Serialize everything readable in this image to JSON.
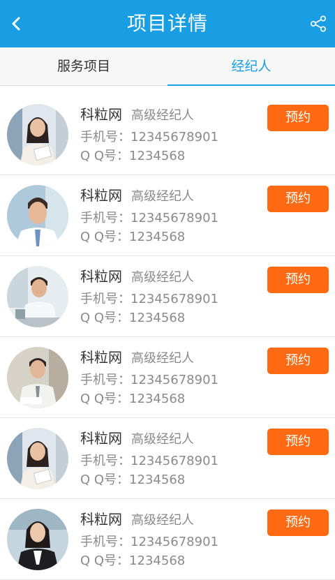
{
  "header": {
    "title": "项目详情",
    "back_icon": "chevron-left-icon",
    "share_icon": "share-icon"
  },
  "tabs": [
    {
      "label": "服务项目",
      "active": false
    },
    {
      "label": "经纪人",
      "active": true
    }
  ],
  "colors": {
    "header_bg": "#1a9ee3",
    "accent": "#1a9ee3",
    "button_bg": "#ff6a13"
  },
  "agents": [
    {
      "name": "科粒网",
      "level": "高级经纪人",
      "phone": "手机号：12345678901",
      "qq": "Q Q号：1234568",
      "button": "预约",
      "avatar": "woman-holding-papers"
    },
    {
      "name": "科粒网",
      "level": "高级经纪人",
      "phone": "手机号：12345678901",
      "qq": "Q Q号：1234568",
      "button": "预约",
      "avatar": "man-smiling"
    },
    {
      "name": "科粒网",
      "level": "高级经纪人",
      "phone": "手机号：12345678901",
      "qq": "Q Q号：1234568",
      "button": "预约",
      "avatar": "man-at-desk"
    },
    {
      "name": "科粒网",
      "level": "高级经纪人",
      "phone": "手机号：12345678901",
      "qq": "Q Q号：1234568",
      "button": "预约",
      "avatar": "man-in-office"
    },
    {
      "name": "科粒网",
      "level": "高级经纪人",
      "phone": "手机号：12345678901",
      "qq": "Q Q号：1234568",
      "button": "预约",
      "avatar": "woman-holding-papers"
    },
    {
      "name": "科粒网",
      "level": "高级经纪人",
      "phone": "手机号：12345678901",
      "qq": "Q Q号：1234568",
      "button": "预约",
      "avatar": "woman-in-suit"
    }
  ]
}
